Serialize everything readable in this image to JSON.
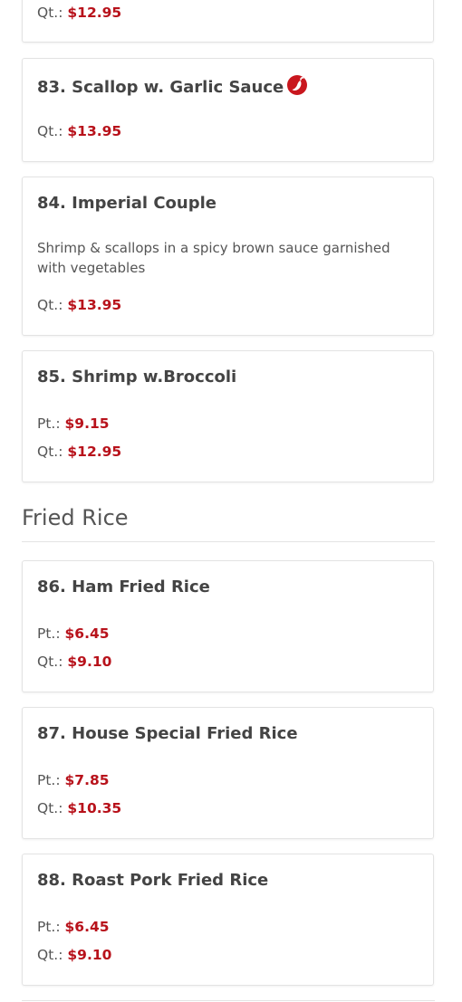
{
  "items": [
    {
      "prices": [
        {
          "label": "Qt.:",
          "amount": "$12.95"
        }
      ]
    },
    {
      "title": "83. Scallop w. Garlic Sauce",
      "spicy": true,
      "prices": [
        {
          "label": "Qt.:",
          "amount": "$13.95"
        }
      ]
    },
    {
      "title": "84. Imperial Couple",
      "description": "Shrimp & scallops in a spicy brown sauce garnished with vegetables",
      "prices": [
        {
          "label": "Qt.:",
          "amount": "$13.95"
        }
      ]
    },
    {
      "title": "85. Shrimp w.Broccoli",
      "prices": [
        {
          "label": "Pt.:",
          "amount": "$9.15"
        },
        {
          "label": "Qt.:",
          "amount": "$12.95"
        }
      ]
    },
    {
      "title": "86. Ham Fried Rice",
      "prices": [
        {
          "label": "Pt.:",
          "amount": "$6.45"
        },
        {
          "label": "Qt.:",
          "amount": "$9.10"
        }
      ]
    },
    {
      "title": "87. House Special Fried Rice",
      "prices": [
        {
          "label": "Pt.:",
          "amount": "$7.85"
        },
        {
          "label": "Qt.:",
          "amount": "$10.35"
        }
      ]
    },
    {
      "title": "88. Roast Pork Fried Rice",
      "prices": [
        {
          "label": "Pt.:",
          "amount": "$6.45"
        },
        {
          "label": "Qt.:",
          "amount": "$9.10"
        }
      ]
    }
  ],
  "section": {
    "title": "Fried Rice"
  },
  "colors": {
    "price": "#b8121b",
    "spicy_icon": "#c9171e"
  },
  "icons": {
    "spicy": "chili-pepper-icon"
  }
}
